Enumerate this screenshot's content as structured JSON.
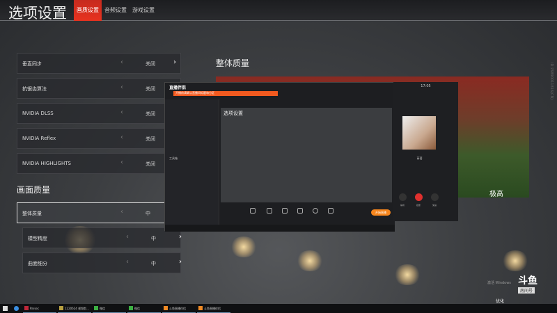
{
  "header": {
    "title": "选项设置",
    "tabs": [
      {
        "label": "画质设置",
        "active": true
      },
      {
        "label": "音频设置"
      },
      {
        "label": "游戏设置"
      }
    ]
  },
  "settings": [
    {
      "label": "垂直同步",
      "value": "关闭"
    },
    {
      "label": "抗锯齿算法",
      "value": "关闭"
    },
    {
      "label": "NVIDIA DLSS",
      "value": "关闭"
    },
    {
      "label": "NVIDIA Reflex",
      "value": "关闭"
    },
    {
      "label": "NVIDIA HIGHLIGHTS",
      "value": "关闭"
    }
  ],
  "quality_heading": "画面质量",
  "quality": [
    {
      "label": "整体质量",
      "value": "中"
    },
    {
      "label": "模型精度",
      "value": "中"
    },
    {
      "label": "曲面细分",
      "value": "中"
    }
  ],
  "preview": {
    "heading": "整体质量",
    "label": "极高"
  },
  "arrows": {
    "left": "‹",
    "right": "›"
  },
  "stream_app": {
    "logo": "直播伴侣",
    "banner": "开播前请确认直播间标题和分区",
    "inner_title": "选项设置",
    "start_label": "开始直播",
    "tools_label": "工具箱"
  },
  "call": {
    "time": "17:05",
    "name": "芮蓓",
    "buttons": [
      "静音",
      "挂断",
      "免提"
    ]
  },
  "taskbar": {
    "items": [
      "Parsec",
      "1220624 视频剪...",
      "微信",
      "微信",
      "斗鱼直播伴侣",
      "斗鱼直播伴侣"
    ]
  },
  "watermark": {
    "logo": "斗鱼",
    "room": "房间号",
    "activate": "激活 Windows",
    "optimize": "优化"
  },
  "version": "ID:76890011816(CN)"
}
